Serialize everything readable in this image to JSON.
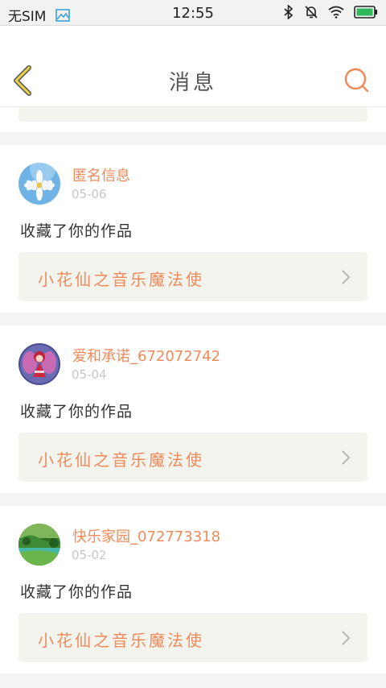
{
  "status_bar": {
    "carrier": "无SIM",
    "time": "12:55"
  },
  "header": {
    "title": "消息"
  },
  "notifications": [
    {
      "username": "匿名信息",
      "date": "05-06",
      "action": "收藏了你的作品",
      "work_title": "小花仙之音乐魔法使",
      "avatar": "daisy-flower-avatar"
    },
    {
      "username": "爱和承诺_672072742",
      "date": "05-04",
      "action": "收藏了你的作品",
      "work_title": "小花仙之音乐魔法使",
      "avatar": "fairy-character-avatar"
    },
    {
      "username": "快乐家园_072773318",
      "date": "05-02",
      "action": "收藏了你的作品",
      "work_title": "小花仙之音乐魔法使",
      "avatar": "green-landscape-avatar"
    }
  ],
  "colors": {
    "accent": "#ef8a5a",
    "back_icon": "#f0d24a",
    "link_bg": "#f4f4ee",
    "date": "#c7c7c7"
  }
}
